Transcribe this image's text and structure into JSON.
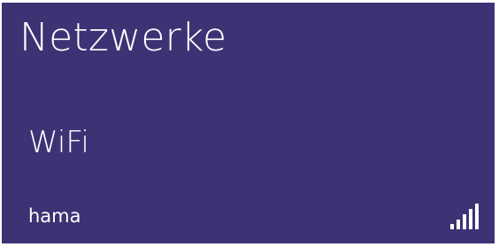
{
  "panel": {
    "title": "Netzwerke",
    "section_heading": "WiFi"
  },
  "networks": [
    {
      "name": "hama",
      "signal_icon": "wifi-signal-bars-icon",
      "signal_strength": "5/5"
    }
  ],
  "colors": {
    "panel_background": "#3e3275",
    "text": "#ffffff"
  }
}
